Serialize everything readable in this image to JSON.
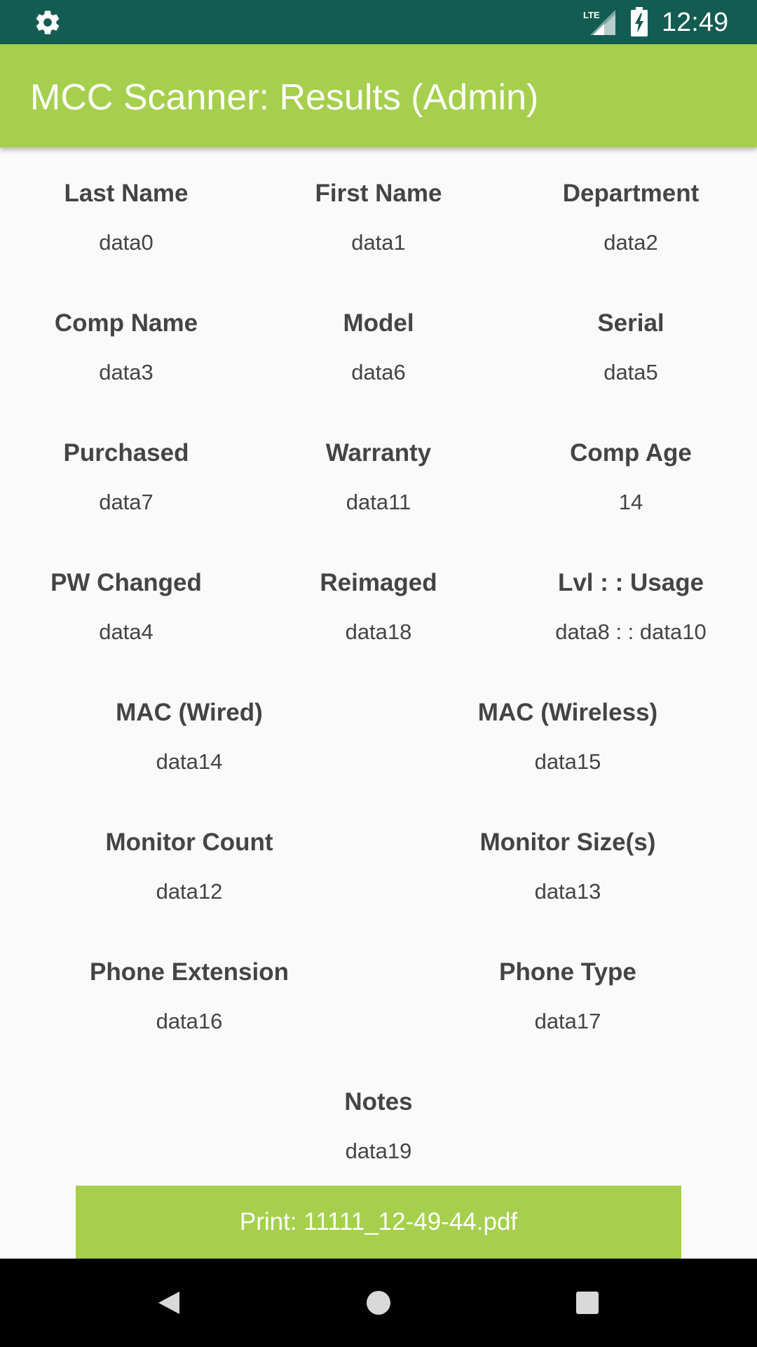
{
  "status_bar": {
    "time": "12:49",
    "network": "LTE",
    "icons": [
      "gear-icon",
      "lte-signal-icon",
      "battery-charging-icon"
    ]
  },
  "app_bar": {
    "title": "MCC Scanner: Results (Admin)"
  },
  "fields": {
    "last_name": {
      "label": "Last Name",
      "value": "data0"
    },
    "first_name": {
      "label": "First Name",
      "value": "data1"
    },
    "department": {
      "label": "Department",
      "value": "data2"
    },
    "comp_name": {
      "label": "Comp Name",
      "value": "data3"
    },
    "model": {
      "label": "Model",
      "value": "data6"
    },
    "serial": {
      "label": "Serial",
      "value": "data5"
    },
    "purchased": {
      "label": "Purchased",
      "value": "data7"
    },
    "warranty": {
      "label": "Warranty",
      "value": "data11"
    },
    "comp_age": {
      "label": "Comp Age",
      "value": "14"
    },
    "pw_changed": {
      "label": "PW Changed",
      "value": "data4"
    },
    "reimaged": {
      "label": "Reimaged",
      "value": "data18"
    },
    "lvl_usage": {
      "label": "Lvl : : Usage",
      "value": "data8 : : data10"
    },
    "mac_wired": {
      "label": "MAC (Wired)",
      "value": "data14"
    },
    "mac_wireless": {
      "label": "MAC (Wireless)",
      "value": "data15"
    },
    "monitor_count": {
      "label": "Monitor Count",
      "value": "data12"
    },
    "monitor_sizes": {
      "label": "Monitor Size(s)",
      "value": "data13"
    },
    "phone_extension": {
      "label": "Phone Extension",
      "value": "data16"
    },
    "phone_type": {
      "label": "Phone Type",
      "value": "data17"
    },
    "notes": {
      "label": "Notes",
      "value": "data19"
    }
  },
  "print_button": {
    "label": "Print: 11111_12-49-44.pdf"
  },
  "nav_bar": {
    "icons": [
      "back-icon",
      "home-icon",
      "recents-icon"
    ]
  },
  "colors": {
    "status_bar": "#135c52",
    "app_bar": "#a5cf4d",
    "background": "#fafafa",
    "text": "#444444"
  }
}
